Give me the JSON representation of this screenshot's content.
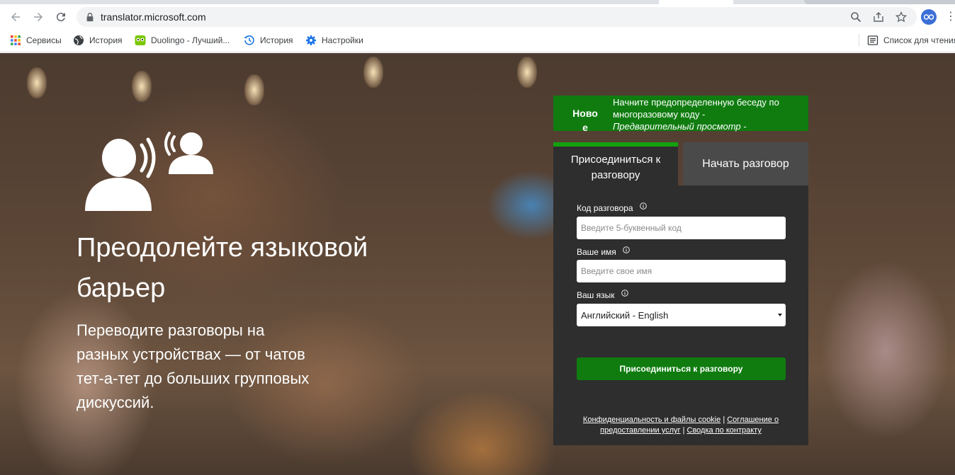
{
  "browser": {
    "url": "translator.microsoft.com",
    "bookmarks": [
      {
        "label": "Сервисы",
        "icon": "apps-grid-icon"
      },
      {
        "label": "История",
        "icon": "globe-icon"
      },
      {
        "label": "Duolingo - Лучший...",
        "icon": "duolingo-owl-icon"
      },
      {
        "label": "История",
        "icon": "history-clock-icon"
      },
      {
        "label": "Настройки",
        "icon": "gear-icon"
      }
    ],
    "reading_list": "Список для чтения"
  },
  "hero": {
    "title": "Преодолейте языковой барьер",
    "subtitle": "Переводите разговоры на разных устройствах — от чатов тет-а-тет до больших групповых дискуссий."
  },
  "banner": {
    "badge": "Ново е",
    "text": "Начните предопределенную беседу по многоразовому коду -",
    "italic": "Предварительный просмотр -"
  },
  "tabs": {
    "join": "Присоединиться к разговору",
    "start": "Начать разговор"
  },
  "form": {
    "code_label": "Код разговора",
    "code_placeholder": "Введите 5-буквенный код",
    "name_label": "Ваше имя",
    "name_placeholder": "Введите свое имя",
    "language_label": "Ваш язык",
    "language_value": "Английский - English",
    "join_button": "Присоединиться к разговору"
  },
  "footer": {
    "privacy": "Конфиденциальность и файлы cookie",
    "terms": "Соглашение о предоставлении услуг",
    "summary": "Сводка по контракту",
    "separator": "|"
  },
  "colors": {
    "brand_green": "#107c10",
    "tab_accent": "#13a10e",
    "card_bg": "#2e2e2e"
  }
}
